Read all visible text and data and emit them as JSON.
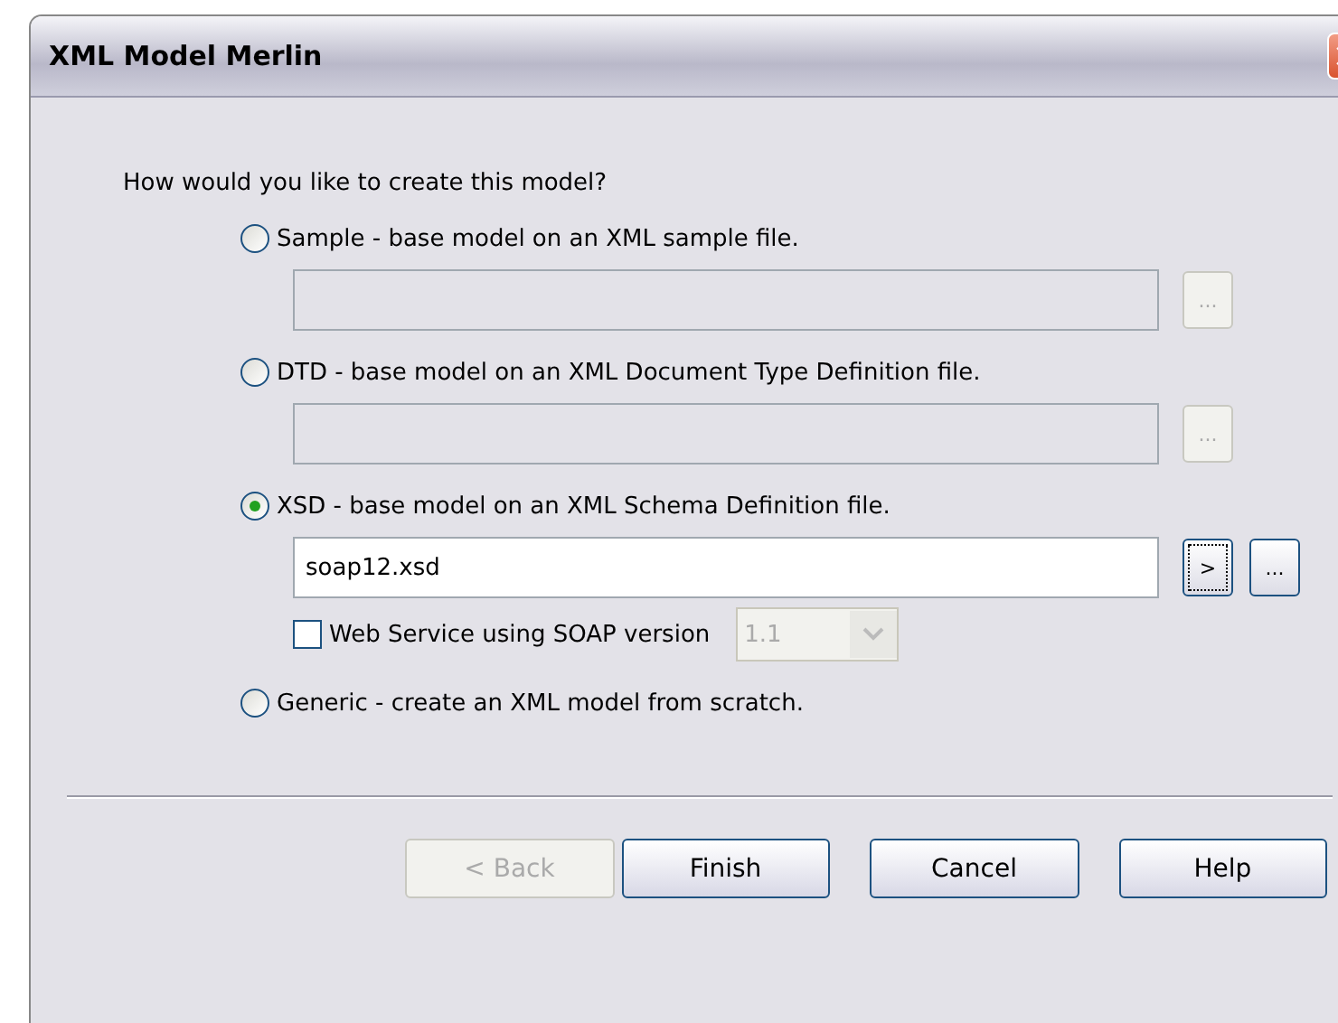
{
  "window": {
    "title": "XML Model Merlin"
  },
  "question": "How would you like to create this model?",
  "options": [
    {
      "label": "Sample - base model on an XML sample file.",
      "selected": false,
      "file_field": {
        "disabled": true
      },
      "browse_button": {
        "label": "...",
        "disabled": true
      }
    },
    {
      "label": "DTD - base model on an XML Document Type Definition file.",
      "selected": false,
      "file_field": {
        "disabled": true
      },
      "browse_button": {
        "label": "...",
        "disabled": true
      }
    },
    {
      "label": "XSD - base model on an XML Schema Definition file.",
      "selected": true,
      "file_field": {
        "value": "soap12.xsd",
        "disabled": false
      },
      "go_button": {
        "label": ">",
        "focused": true
      },
      "browse_button": {
        "label": "...",
        "disabled": false
      },
      "soap": {
        "label": "Web Service using SOAP version",
        "checked": false,
        "version": {
          "value": "1.1",
          "disabled": true
        }
      }
    },
    {
      "label": "Generic - create an XML model from scratch.",
      "selected": false
    }
  ],
  "buttons": [
    {
      "label": "< Back",
      "disabled": true
    },
    {
      "label": "Finish",
      "disabled": false
    },
    {
      "label": "Cancel",
      "disabled": false
    },
    {
      "label": "Help",
      "disabled": false
    }
  ]
}
